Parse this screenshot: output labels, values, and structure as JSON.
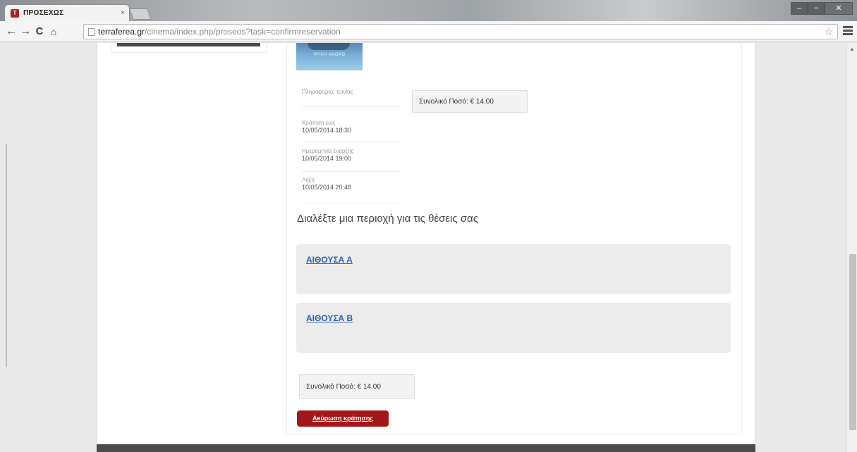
{
  "browser": {
    "tab_title": "ΠΡΟΣΕΧΩΣ",
    "tab_close": "×",
    "favicon_text": "T",
    "url_domain": "terraferea.gr",
    "url_path": "/cinema/index.php/proseos?task=confirmreservation",
    "window_controls": {
      "minimize": "–",
      "maximize": "▫",
      "close": "✕"
    },
    "nav": {
      "back": "←",
      "forward": "→",
      "reload": "C",
      "home": "⌂"
    },
    "star": "☆",
    "scroll_arrow": "▲"
  },
  "poster": {
    "text": "ΨΥΧΗ ΑΝΘΡΩ"
  },
  "info": [
    {
      "label": "Πληροφορίες ταινίας",
      "value": ""
    },
    {
      "label": "Κράτηση έως",
      "value": "10/05/2014 18:30"
    },
    {
      "label": "Ημερομηνία έναρξης",
      "value": "10/05/2014 19:00"
    },
    {
      "label": "Λήξη",
      "value": "10/05/2014 20:48"
    }
  ],
  "total_label": "Συνολικό Ποσό: € 14.00",
  "choose_area_heading": "Διαλέξτε μια περιοχή για τις θέσεις σας",
  "halls": [
    {
      "name": "ΑΙΘΟΥΣΑ Α"
    },
    {
      "name": "ΑΙΘΟΥΣΑ Β"
    }
  ],
  "cancel_button": "Ακύρωση κράτησης",
  "colors": {
    "cancel_button": "#a5161a",
    "link": "#2a62a8",
    "panel": "#ececec"
  }
}
